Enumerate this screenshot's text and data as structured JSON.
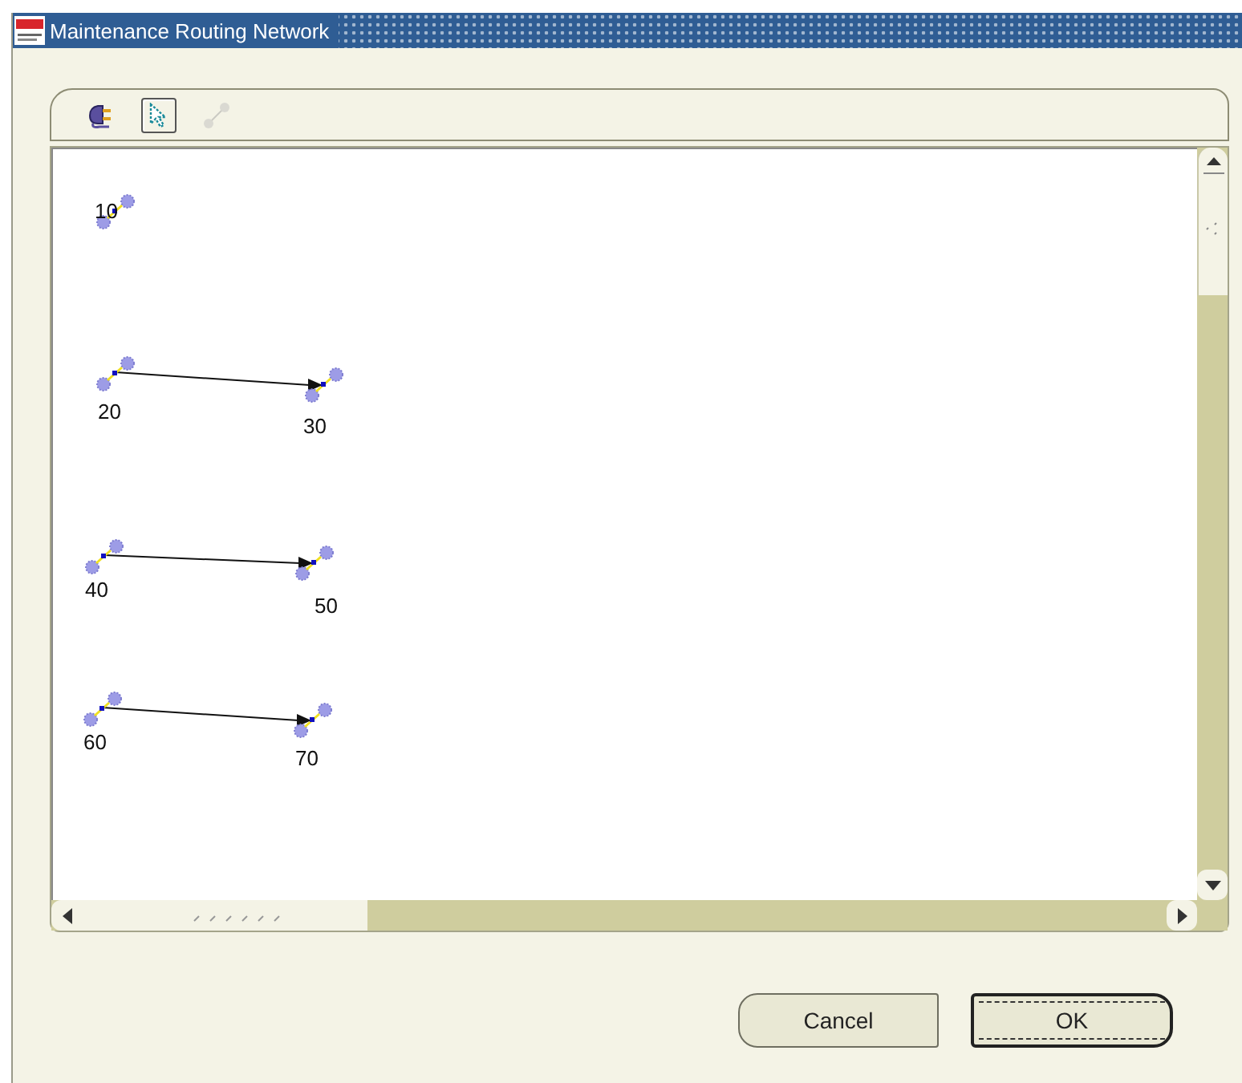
{
  "window": {
    "title": "Maintenance Routing Network"
  },
  "toolbar": {
    "tools": [
      {
        "kind": "plug",
        "selected": false,
        "disabled": false
      },
      {
        "kind": "pointer",
        "selected": true,
        "disabled": false
      },
      {
        "kind": "link",
        "selected": false,
        "disabled": true
      }
    ]
  },
  "network": {
    "routes": [
      {
        "steps": [
          "10"
        ]
      },
      {
        "steps": [
          "20",
          "30"
        ]
      },
      {
        "steps": [
          "40",
          "50"
        ]
      },
      {
        "steps": [
          "60",
          "70"
        ]
      }
    ]
  },
  "buttons": [
    {
      "label": "Cancel",
      "default": false
    },
    {
      "label": "OK",
      "default": true
    }
  ]
}
